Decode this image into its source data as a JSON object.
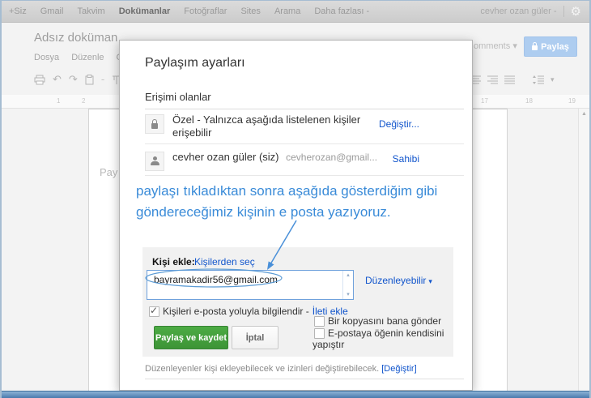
{
  "topbar": {
    "items": [
      "+Siz",
      "Gmail",
      "Takvim",
      "Dokümanlar",
      "Fotoğraflar",
      "Sites",
      "Arama",
      "Daha fazlası -"
    ],
    "user": "cevher ozan güler -",
    "gear_glyph": "⚙"
  },
  "doc": {
    "title": "Adsız doküman",
    "menu": [
      "Dosya",
      "Düzenle",
      "Görün"
    ],
    "comments_label": "omments",
    "comments_caret": "▾",
    "share_button": "Paylaş",
    "page_text": "Pay",
    "ruler_left_1": "1",
    "ruler_left_2": "2",
    "ruler_right_1": "17",
    "ruler_right_2": "18",
    "ruler_right_3": "19",
    "scroll_up_glyph": "▲",
    "undo_glyph": "↶",
    "redo_glyph": "↷",
    "toolbar_dash": "-",
    "spacing_caret": "▾"
  },
  "dialog": {
    "title": "Paylaşım ayarları",
    "section_title": "Erişimi olanlar",
    "rows": [
      {
        "text_line1": "Özel - Yalnızca aşağıda listelenen kişiler",
        "text_line2": "erişebilir",
        "action": "Değiştir..."
      },
      {
        "name": "cevher ozan güler (siz)",
        "email": "cevherozan@gmail...",
        "action": "Sahibi"
      }
    ],
    "annotation_line1": "paylaşı tıkladıktan sonra aşağıda gösterdiğim gibi",
    "annotation_line2": "göndereceğimiz kişinin e posta yazıyoruz.",
    "panel": {
      "add_label": "Kişi ekle:",
      "choose_link": "Kişilerden seç",
      "email_value": "bayramakadir56@gmail.com",
      "permission_label": "Düzenleyebilir",
      "permission_caret": "▾",
      "spinner_up": "▴",
      "spinner_down": "▾",
      "notify_label": "Kişileri e-posta yoluyla bilgilendir - ",
      "notify_link": "İleti ekle",
      "share_save_button": "Paylaş ve kaydet",
      "cancel_button": "İptal",
      "copy_checkbox_label": "Bir kopyasını bana gönder",
      "paste_checkbox_label": "E-postaya öğenin kendisini yapıştır"
    },
    "footer_text": "Düzenleyenler kişi ekleyebilecek ve izinleri değiştirebilecek. ",
    "footer_link": "[Değiştir]"
  },
  "colors": {
    "link_blue": "#1155cc",
    "annotation_blue": "#3a8bd8",
    "share_green": "#44a13d",
    "topbar_grey": "#d6d6d6",
    "bottombar_blue": "#4a7aad"
  }
}
